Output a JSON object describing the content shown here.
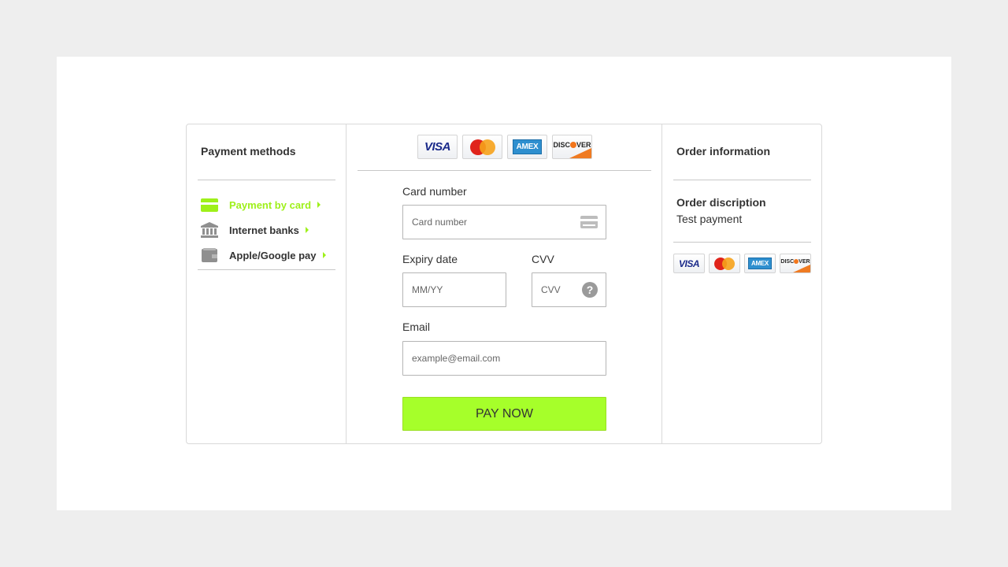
{
  "payment_methods": {
    "title": "Payment methods",
    "items": [
      {
        "label": "Payment by card",
        "icon": "card-icon",
        "active": true
      },
      {
        "label": "Internet banks",
        "icon": "bank-icon",
        "active": false
      },
      {
        "label": "Apple/Google pay",
        "icon": "wallet-icon",
        "active": false
      }
    ]
  },
  "card_logos": {
    "visa": "VISA",
    "mastercard": "MasterCard",
    "amex": "AMEX",
    "discover": "DISCOVER"
  },
  "form": {
    "card_number_label": "Card number",
    "card_number_placeholder": "Card number",
    "expiry_label": "Expiry date",
    "expiry_placeholder": "MM/YY",
    "cvv_label": "CVV",
    "cvv_placeholder": "CVV",
    "email_label": "Email",
    "email_placeholder": "example@email.com",
    "pay_button": "PAY NOW"
  },
  "order": {
    "title": "Order information",
    "description_label": "Order discription",
    "description_value": "Test payment"
  },
  "colors": {
    "accent": "#a6ff2a",
    "active_method": "#9ef01a",
    "background": "#eeeeee"
  }
}
